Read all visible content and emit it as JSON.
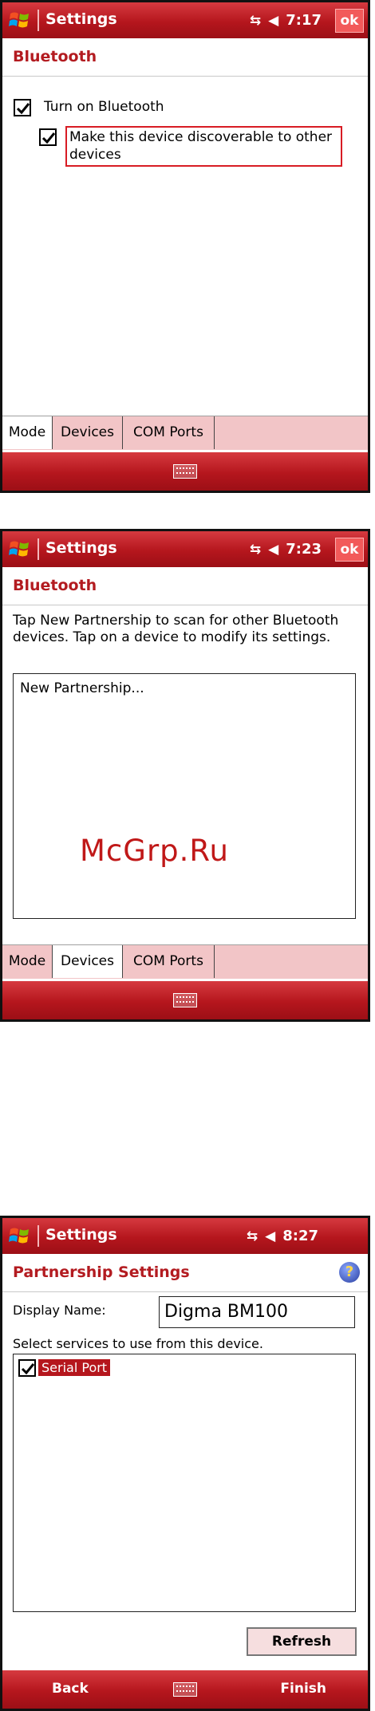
{
  "screen1": {
    "title": "Settings",
    "time": "7:17",
    "ok_label": "ok",
    "header": "Bluetooth",
    "turn_on_label": "Turn on Bluetooth",
    "discoverable_label_line1": "Make this device discoverable to other",
    "discoverable_label_line2": "devices",
    "tabs": [
      "Mode",
      "Devices",
      "COM Ports"
    ],
    "active_tab": "Mode"
  },
  "screen2": {
    "title": "Settings",
    "time": "7:23",
    "ok_label": "ok",
    "header": "Bluetooth",
    "description": "Tap New Partnership to scan for other Bluetooth devices. Tap on a device to modify its settings.",
    "list_item": "New Partnership...",
    "tabs": [
      "Mode",
      "Devices",
      "COM Ports"
    ],
    "active_tab": "Devices"
  },
  "watermark": "McGrp.Ru",
  "screen3": {
    "title": "Settings",
    "time": "8:27",
    "header": "Partnership Settings",
    "display_name_label": "Display Name:",
    "display_name_value": "Digma BM100",
    "services_label": "Select services to use from this device.",
    "service_item": "Serial Port",
    "refresh_label": "Refresh",
    "back_label": "Back",
    "finish_label": "Finish"
  },
  "colors": {
    "accent": "#b5161d",
    "tab_bg": "#f2c5c7"
  },
  "icons": [
    "windows-logo-icon",
    "connectivity-icon",
    "volume-icon",
    "keyboard-icon",
    "help-icon",
    "checkmark-icon"
  ]
}
